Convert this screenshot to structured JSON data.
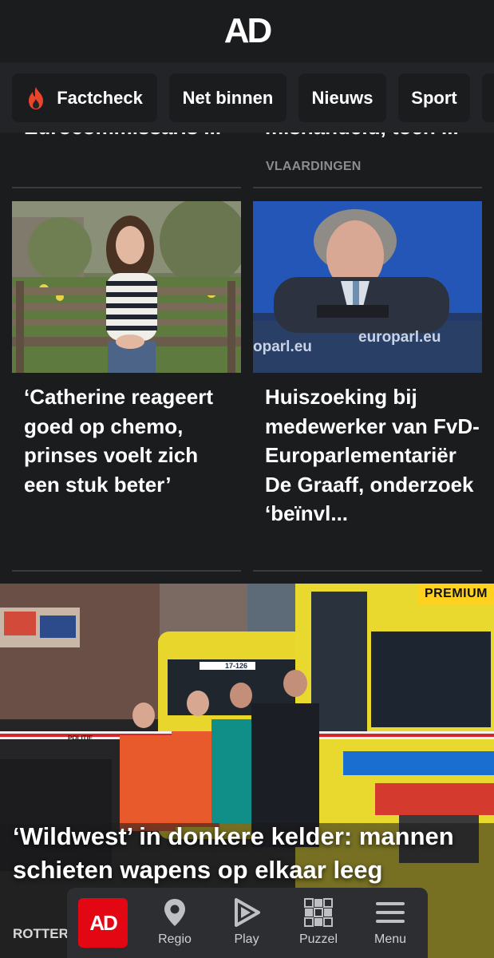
{
  "header": {
    "logo": "AD"
  },
  "nav": {
    "chips": [
      {
        "label": "Factcheck",
        "icon": "flame-icon"
      },
      {
        "label": "Net binnen"
      },
      {
        "label": "Nieuws"
      },
      {
        "label": "Sport"
      }
    ]
  },
  "feed": {
    "prev_left_title": "Eurocommissaris ...",
    "prev_right_title": "mishandeld, toen ...",
    "prev_right_tag": "VLAARDINGEN",
    "articles": [
      {
        "headline": "‘Catherine reageert goed op chemo, prinses voelt zich een stuk beter’"
      },
      {
        "headline": "Huiszoeking bij medewerker van FvD-Europarlementariër De Graaff, onderzoek ‘beïnvl...",
        "image_text_1": "europarl.eu",
        "image_text_2": "oparl.eu"
      }
    ]
  },
  "hero": {
    "badge": "PREMIUM",
    "headline": "‘Wildwest’ in donkere kelder: mannen schieten wapens op elkaar leeg",
    "location": "ROTTERDAM",
    "image_text_1": "17-126",
    "image_text_2": "POLITIE"
  },
  "bottom_nav": {
    "logo": "AD",
    "items": [
      {
        "label": "Regio",
        "icon": "location-pin-icon"
      },
      {
        "label": "Play",
        "icon": "play-icon"
      },
      {
        "label": "Puzzel",
        "icon": "puzzle-grid-icon"
      },
      {
        "label": "Menu",
        "icon": "hamburger-menu-icon"
      }
    ]
  },
  "colors": {
    "background": "#1b1c1e",
    "nav_bg": "#232427",
    "brand_red": "#e30613",
    "premium_yellow": "#ffd21f",
    "flame": "#e8452c"
  }
}
